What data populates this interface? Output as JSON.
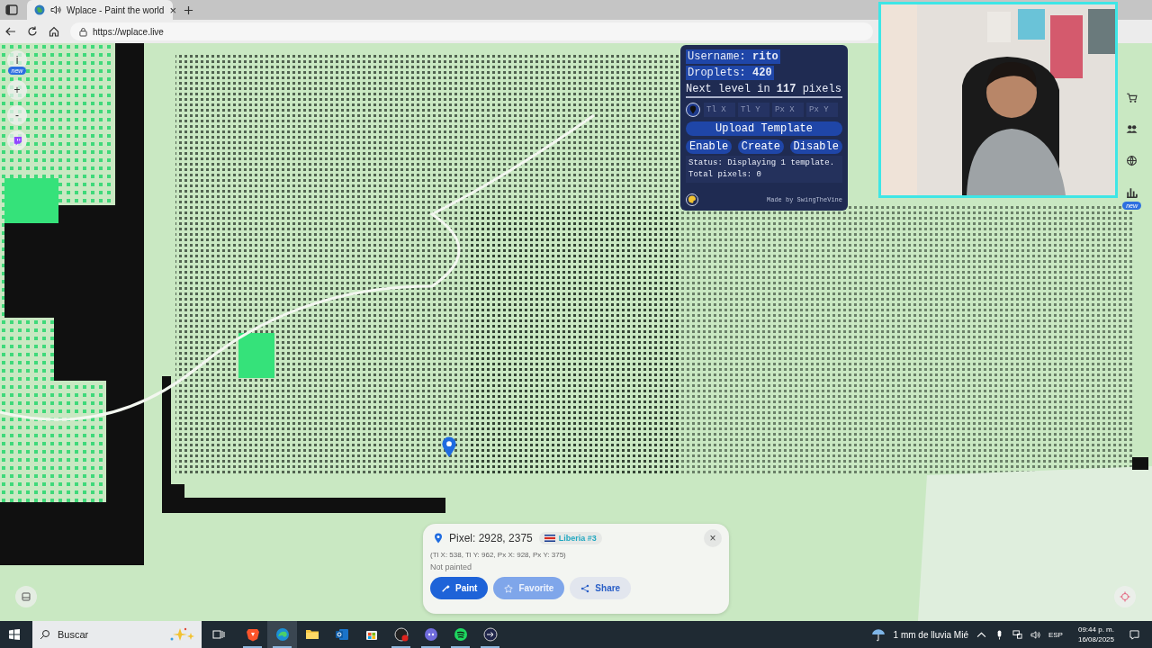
{
  "browser": {
    "tab": {
      "title": "Wplace - Paint the world",
      "audible": true,
      "close": "×"
    },
    "url": "https://wplace.live"
  },
  "map_controls": {
    "info": "i",
    "info_badge": "new",
    "zoom_in": "+",
    "zoom_out": "-"
  },
  "right_toolbar": {
    "badge": "new"
  },
  "template_panel": {
    "username_line": "Username: **rito**",
    "droplets_line": "Droplets: **420**",
    "level_line": "Next level in **117** pixels",
    "coordinate_fields": [
      {
        "placeholder": "Tl X"
      },
      {
        "placeholder": "Tl Y"
      },
      {
        "placeholder": "Px X"
      },
      {
        "placeholder": "Px Y"
      }
    ],
    "upload_button": "Upload Template",
    "buttons": [
      "Enable",
      "Create",
      "Disable"
    ],
    "status_lines": [
      "Status: Displaying 1 template.",
      "Total pixels: 0"
    ],
    "credit": "Made by SwingTheVine"
  },
  "pixel_popup": {
    "title": "Pixel: 2928, 2375",
    "region": "Liberia #3",
    "coordinates": "(Tl X: 538, Tl Y: 962, Px X: 928, Px Y: 375)",
    "status": "Not painted",
    "close": "×",
    "buttons": [
      {
        "kind": "paint",
        "label": "Paint",
        "disabled": false
      },
      {
        "kind": "favorite",
        "label": "Favorite",
        "disabled": true
      },
      {
        "kind": "share",
        "label": "Share",
        "disabled": false
      }
    ]
  },
  "taskbar": {
    "search_placeholder": "Buscar",
    "apps": [
      {
        "kind": "brave",
        "selected": false,
        "running": true
      },
      {
        "kind": "edge",
        "selected": true,
        "running": true
      },
      {
        "kind": "folder",
        "selected": false,
        "running": false
      },
      {
        "kind": "mail",
        "selected": false,
        "running": false
      },
      {
        "kind": "store",
        "selected": false,
        "running": false
      },
      {
        "kind": "record",
        "selected": false,
        "running": true
      },
      {
        "kind": "chat",
        "selected": false,
        "running": true
      },
      {
        "kind": "music",
        "selected": false,
        "running": true
      },
      {
        "kind": "arrow",
        "selected": false,
        "running": true
      }
    ],
    "weather": "1 mm de lluvia Mié",
    "language": "ESP",
    "time": "09:44 p. m.",
    "date": "16/08/2025"
  }
}
